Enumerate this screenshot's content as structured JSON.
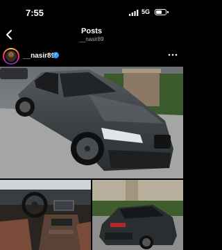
{
  "status_bar": {
    "time": "7:55",
    "network": "5G",
    "battery_level": 0.6
  },
  "header": {
    "title": "Posts",
    "subtitle": "__nasir89",
    "back_icon": "chevron-left-icon"
  },
  "post": {
    "username": "__nasir89",
    "verified": true,
    "verified_icon": "verified-badge-icon",
    "more_icon": "more-dots-icon"
  },
  "colors": {
    "background": "#000000",
    "verified": "#3897f0",
    "secondary_text": "#a8a8a8"
  }
}
